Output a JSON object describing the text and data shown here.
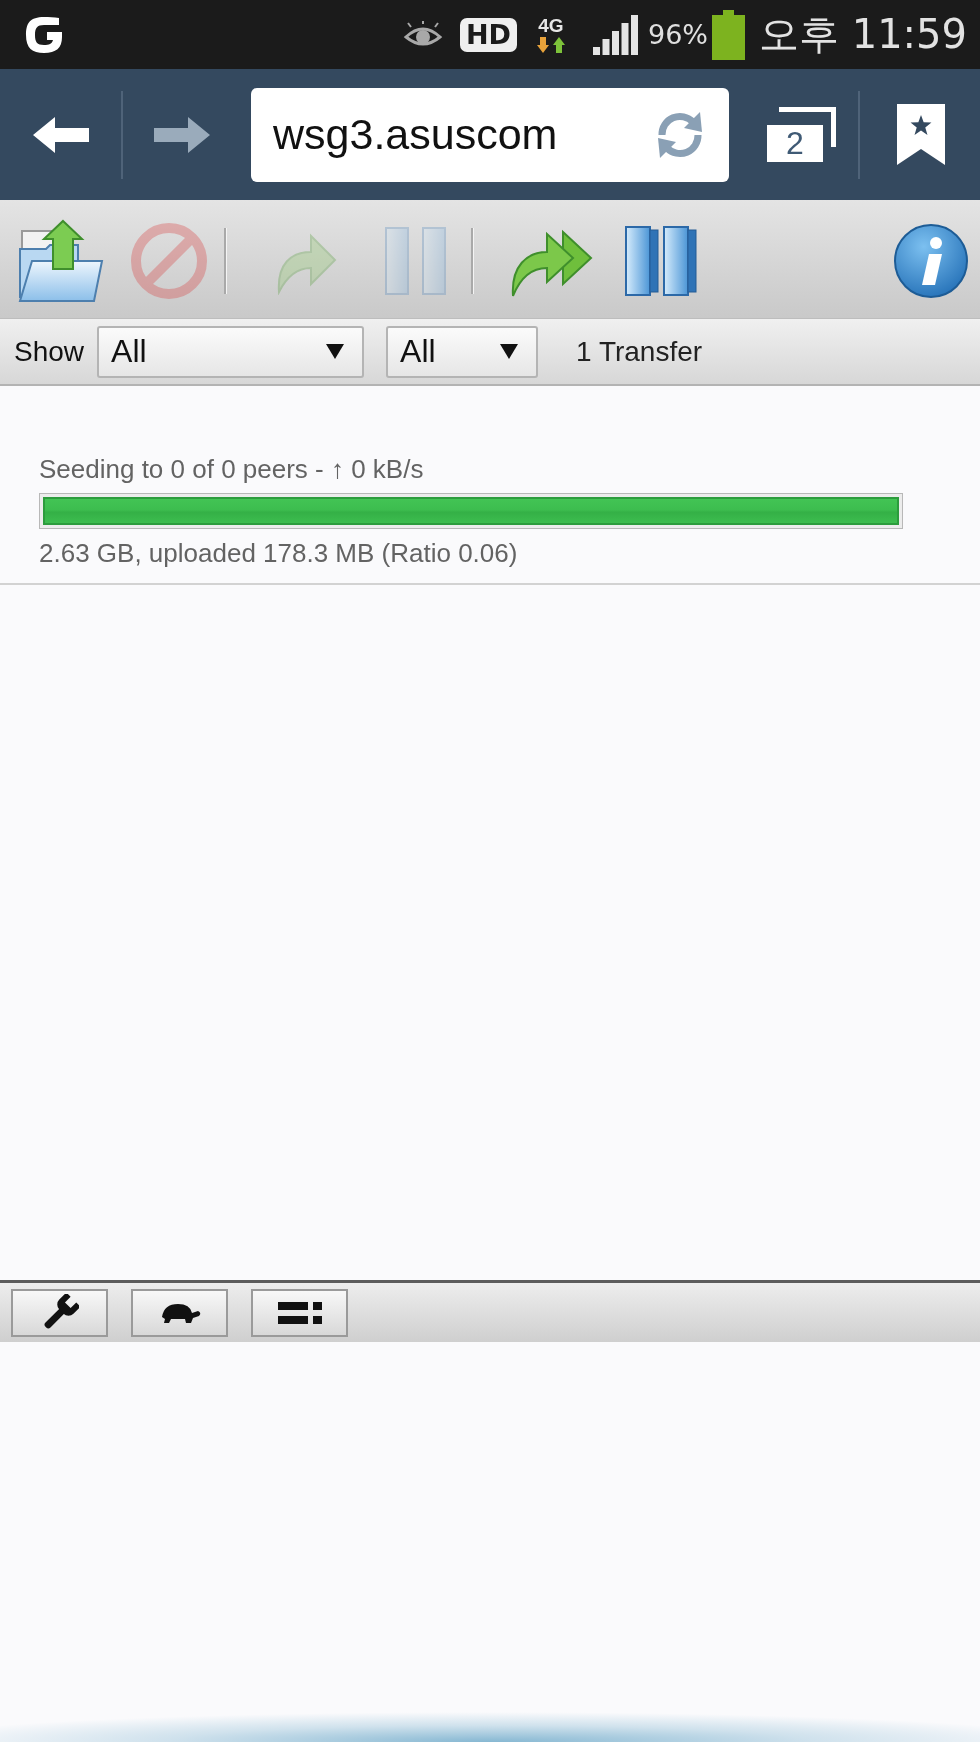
{
  "status_bar": {
    "hd": "HD",
    "network": "4G",
    "battery": "96%",
    "time": "오후 11:59"
  },
  "browser": {
    "back": {
      "disabled": false
    },
    "forward": {
      "disabled": true
    },
    "url": "wsg3.asuscom",
    "tab_count": "2"
  },
  "toolbar": {
    "groups": [
      {
        "buttons": [
          {
            "kind": "open",
            "disabled": false
          },
          {
            "kind": "remove",
            "disabled": true
          }
        ]
      },
      {
        "buttons": [
          {
            "kind": "resume",
            "disabled": true
          },
          {
            "kind": "pause",
            "disabled": true
          }
        ]
      },
      {
        "buttons": [
          {
            "kind": "resume_all",
            "disabled": false
          },
          {
            "kind": "pause_all",
            "disabled": false
          }
        ]
      }
    ],
    "end_buttons": [
      {
        "kind": "info",
        "disabled": false
      }
    ]
  },
  "filter_bar": {
    "label": "Show",
    "selects": [
      {
        "value": "All"
      },
      {
        "value": "All"
      }
    ],
    "count": "1 Transfer"
  },
  "transfers": [
    {
      "status": "Seeding to 0 of 0 peers - ↑ 0 kB/s",
      "level": 1,
      "details": "2.63 GB, uploaded 178.3 MB (Ratio 0.06)"
    }
  ],
  "footer_toolbar": {
    "buttons": [
      {
        "kind": "settings"
      },
      {
        "kind": "turtle"
      },
      {
        "kind": "compact"
      }
    ]
  }
}
